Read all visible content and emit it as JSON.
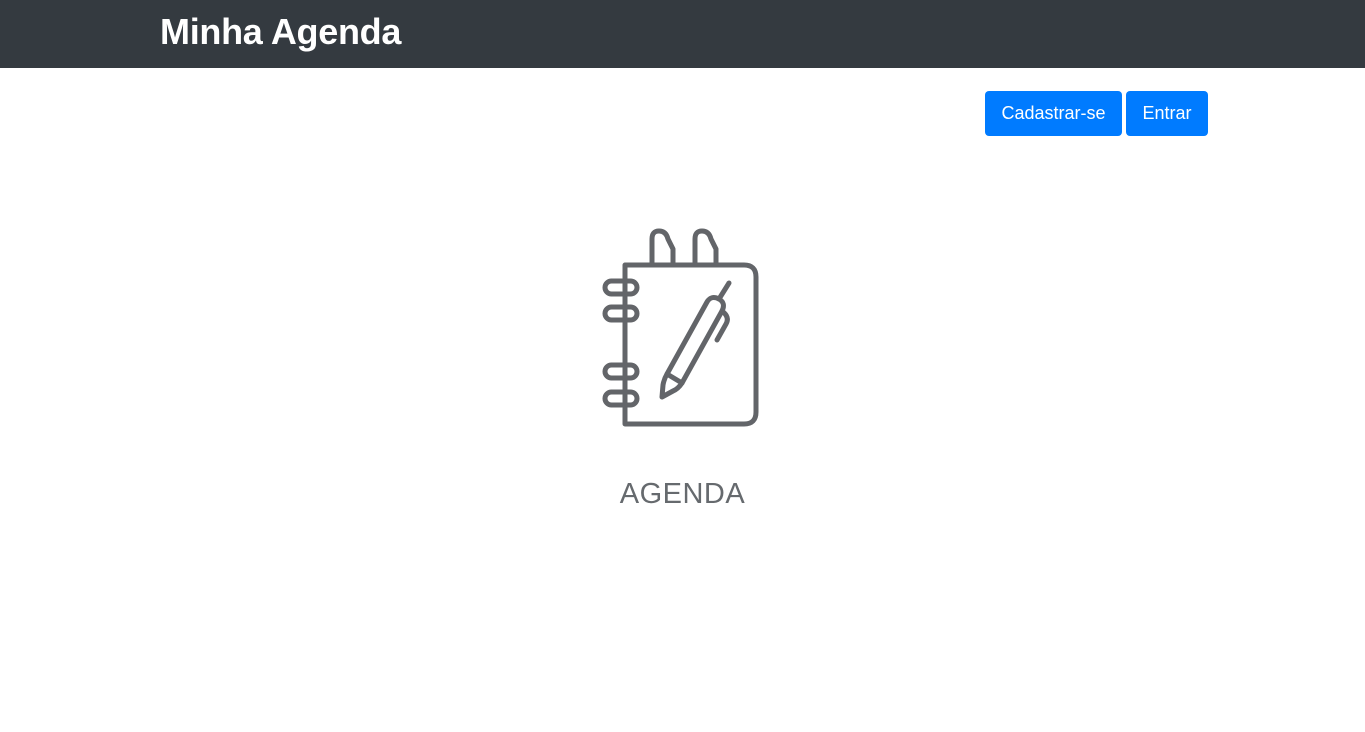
{
  "header": {
    "title": "Minha Agenda"
  },
  "actions": {
    "signup_label": "Cadastrar-se",
    "login_label": "Entrar"
  },
  "hero": {
    "icon": "notebook-pen-icon",
    "label": "AGENDA"
  },
  "colors": {
    "navbar_bg": "#343a40",
    "button_bg": "#007bff",
    "icon_stroke": "#636569"
  }
}
